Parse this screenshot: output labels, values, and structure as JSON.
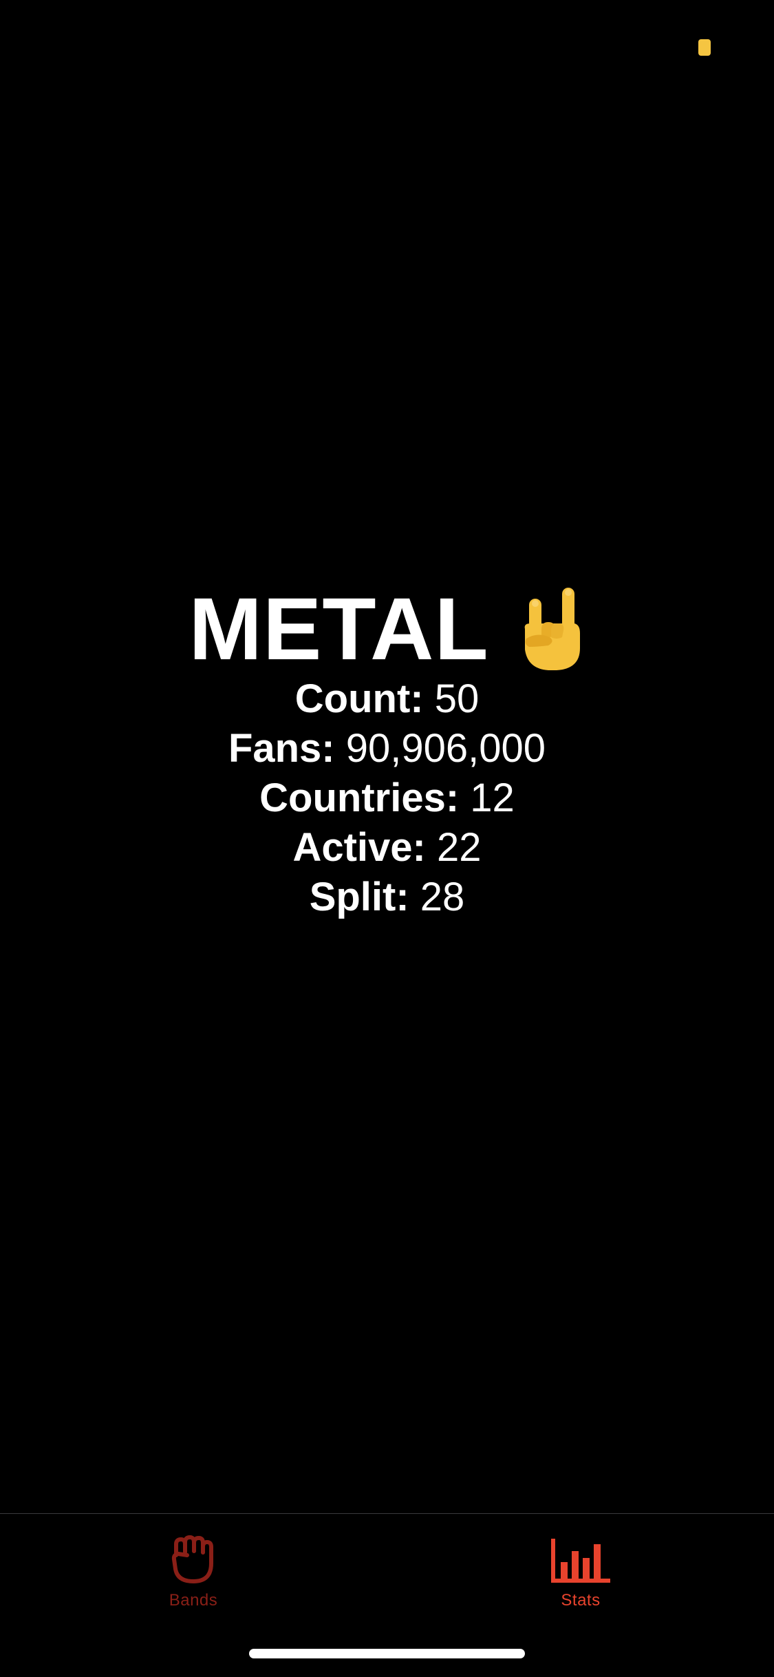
{
  "status": {
    "indicator_color": "#f5c542"
  },
  "genre": {
    "title": "METAL",
    "emoji_icon": "rock-on-hand-icon"
  },
  "stats": [
    {
      "label": "Count:",
      "value": "50"
    },
    {
      "label": "Fans:",
      "value": "90,906,000"
    },
    {
      "label": "Countries:",
      "value": "12"
    },
    {
      "label": "Active:",
      "value": "22"
    },
    {
      "label": "Split:",
      "value": "28"
    }
  ],
  "tabbar": {
    "items": [
      {
        "label": "Bands",
        "icon": "fist-icon",
        "selected": false
      },
      {
        "label": "Stats",
        "icon": "bar-chart-icon",
        "selected": true
      }
    ],
    "colors": {
      "selected": "#e8432d",
      "unselected": "#8a1f17"
    }
  }
}
